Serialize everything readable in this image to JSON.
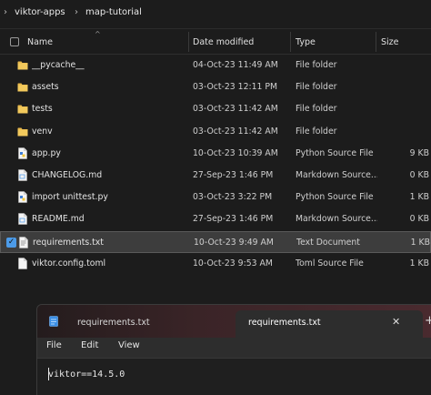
{
  "breadcrumb": {
    "items": [
      "viktor-apps",
      "map-tutorial"
    ]
  },
  "columns": {
    "name": "Name",
    "date": "Date modified",
    "type": "Type",
    "size": "Size"
  },
  "files": [
    {
      "name": "__pycache__",
      "date": "04-Oct-23 11:49 AM",
      "type": "File folder",
      "size": "",
      "icon": "folder-icon"
    },
    {
      "name": "assets",
      "date": "03-Oct-23 12:11 PM",
      "type": "File folder",
      "size": "",
      "icon": "folder-icon"
    },
    {
      "name": "tests",
      "date": "03-Oct-23 11:42 AM",
      "type": "File folder",
      "size": "",
      "icon": "folder-icon"
    },
    {
      "name": "venv",
      "date": "03-Oct-23 11:42 AM",
      "type": "File folder",
      "size": "",
      "icon": "folder-icon"
    },
    {
      "name": "app.py",
      "date": "10-Oct-23 10:39 AM",
      "type": "Python Source File",
      "size": "9 KB",
      "icon": "python-file-icon"
    },
    {
      "name": "CHANGELOG.md",
      "date": "27-Sep-23 1:46 PM",
      "type": "Markdown Source...",
      "size": "0 KB",
      "icon": "document-file-icon"
    },
    {
      "name": "import unittest.py",
      "date": "03-Oct-23 3:22 PM",
      "type": "Python Source File",
      "size": "1 KB",
      "icon": "python-file-icon"
    },
    {
      "name": "README.md",
      "date": "27-Sep-23 1:46 PM",
      "type": "Markdown Source...",
      "size": "0 KB",
      "icon": "document-file-icon"
    },
    {
      "name": "requirements.txt",
      "date": "10-Oct-23 9:49 AM",
      "type": "Text Document",
      "size": "1 KB",
      "icon": "text-file-icon",
      "selected": true
    },
    {
      "name": "viktor.config.toml",
      "date": "10-Oct-23 9:53 AM",
      "type": "Toml Source File",
      "size": "1 KB",
      "icon": "blank-file-icon"
    }
  ],
  "notepad": {
    "inactive_tab": "requirements.txt",
    "active_tab": "requirements.txt",
    "close_glyph": "✕",
    "new_tab_glyph": "+",
    "menu": [
      "File",
      "Edit",
      "View"
    ],
    "content": "viktor==14.5.0"
  },
  "colors": {
    "folder": "#e8b84a",
    "selection_check": "#4c9be8"
  }
}
